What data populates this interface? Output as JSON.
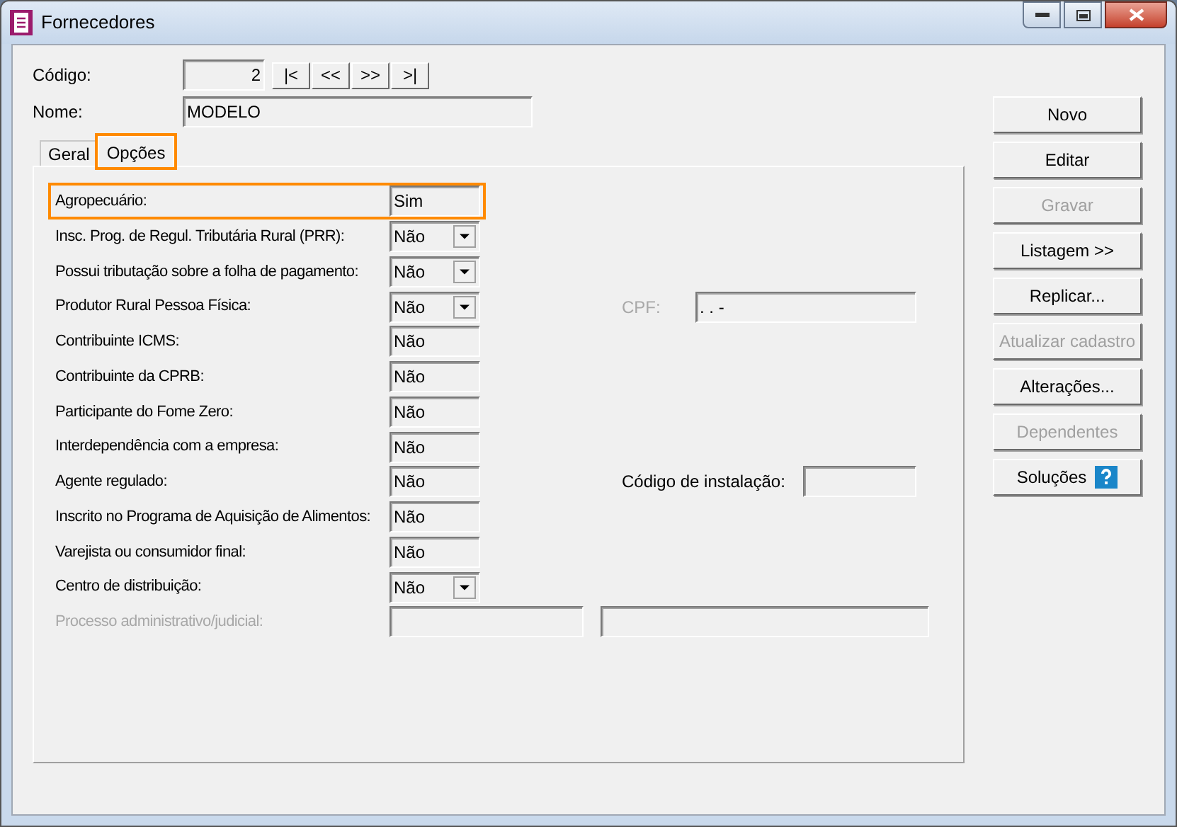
{
  "window": {
    "title": "Fornecedores"
  },
  "header": {
    "code_label": "Código:",
    "code_value": "2",
    "name_label": "Nome:",
    "name_value": "MODELO"
  },
  "nav_buttons": [
    "|<",
    "<<",
    ">>",
    ">|"
  ],
  "tabs": [
    {
      "label": "Geral",
      "selected": false,
      "highlighted": false
    },
    {
      "label": "Opções",
      "selected": true,
      "highlighted": true
    }
  ],
  "options": [
    {
      "label": "Agropecuário:",
      "value": "Sim",
      "kind": "field",
      "disabled": false,
      "highlighted": true
    },
    {
      "label": "Insc. Prog. de Regul. Tributária Rural (PRR):",
      "value": "Não",
      "kind": "combo",
      "disabled": false,
      "highlighted": false
    },
    {
      "label": "Possui tributação sobre a folha de pagamento:",
      "value": "Não",
      "kind": "combo",
      "disabled": false,
      "highlighted": false
    },
    {
      "label": "Produtor Rural Pessoa Física:",
      "value": "Não",
      "kind": "combo",
      "disabled": false,
      "highlighted": false,
      "side": {
        "label": "CPF:",
        "value": ".   .   -",
        "disabled": true,
        "kind": "wide"
      }
    },
    {
      "label": "Contribuinte ICMS:",
      "value": "Não",
      "kind": "field",
      "disabled": false,
      "highlighted": false
    },
    {
      "label": "Contribuinte da CPRB:",
      "value": "Não",
      "kind": "field",
      "disabled": false,
      "highlighted": false
    },
    {
      "label": "Participante do Fome Zero:",
      "value": "Não",
      "kind": "field",
      "disabled": false,
      "highlighted": false
    },
    {
      "label": "Interdependência com a empresa:",
      "value": "Não",
      "kind": "field",
      "disabled": false,
      "highlighted": false
    },
    {
      "label": "Agente regulado:",
      "value": "Não",
      "kind": "field",
      "disabled": false,
      "highlighted": false,
      "side": {
        "label": "Código de instalação:",
        "disabled": false,
        "kind": "narrow"
      }
    },
    {
      "label": "Inscrito no Programa de Aquisição de Alimentos:",
      "value": "Não",
      "kind": "field",
      "disabled": false,
      "highlighted": false
    },
    {
      "label": "Varejista ou consumidor final:",
      "value": "Não",
      "kind": "field",
      "disabled": false,
      "highlighted": false
    },
    {
      "label": "Centro de distribuição:",
      "value": "Não",
      "kind": "combo",
      "disabled": false,
      "highlighted": false
    },
    {
      "label": "Processo administrativo/judicial:",
      "kind": "pair",
      "disabled": true,
      "highlighted": false
    }
  ],
  "buttons": [
    {
      "label": "Novo",
      "disabled": false
    },
    {
      "label": "Editar",
      "disabled": false
    },
    {
      "label": "Gravar",
      "disabled": true
    },
    {
      "label": "Listagem >>",
      "disabled": false
    },
    {
      "label": "Replicar...",
      "disabled": false
    },
    {
      "label": "Atualizar cadastro",
      "disabled": true
    },
    {
      "label": "Alterações...",
      "disabled": false
    },
    {
      "label": "Dependentes",
      "disabled": true
    },
    {
      "label": "Soluções",
      "disabled": false,
      "kind": "help"
    }
  ]
}
